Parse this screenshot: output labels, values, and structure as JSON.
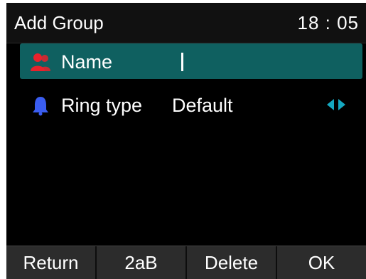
{
  "header": {
    "title": "Add Group",
    "clock": "18 : 05"
  },
  "fields": [
    {
      "label": "Name",
      "value": "",
      "icon": "contacts-icon",
      "icon_color": "#e8222c"
    },
    {
      "label": "Ring type",
      "value": "Default",
      "icon": "bell-icon",
      "icon_color": "#3a5df0"
    }
  ],
  "softkeys": [
    "Return",
    "2aB",
    "Delete",
    "OK"
  ],
  "colors": {
    "selection": "#0f6060",
    "arrow": "#15a8c0"
  }
}
